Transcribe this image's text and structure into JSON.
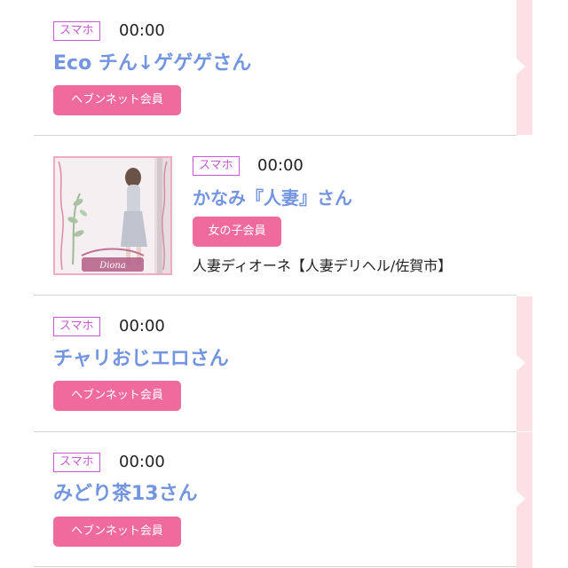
{
  "entries": [
    {
      "device": "スマホ",
      "time": "00:00",
      "name": "Eco チん↓ゲゲゲさん",
      "member": "ヘブンネット会員"
    },
    {
      "device": "スマホ",
      "time": "00:00",
      "name": "かなみ『人妻』さん",
      "member": "女の子会員",
      "shop": "人妻ディオーネ【人妻デリヘル/佐賀市】",
      "photo_caption": "Diona"
    },
    {
      "device": "スマホ",
      "time": "00:00",
      "name": "チャリおじエロさん",
      "member": "ヘブンネット会員"
    },
    {
      "device": "スマホ",
      "time": "00:00",
      "name": "みどり茶13さん",
      "member": "ヘブンネット会員"
    }
  ],
  "colors": {
    "name": "#7395e0",
    "device_badge": "#c95ad6",
    "member_badge": "#f06b9d",
    "side_tab": "#fde0e3"
  }
}
